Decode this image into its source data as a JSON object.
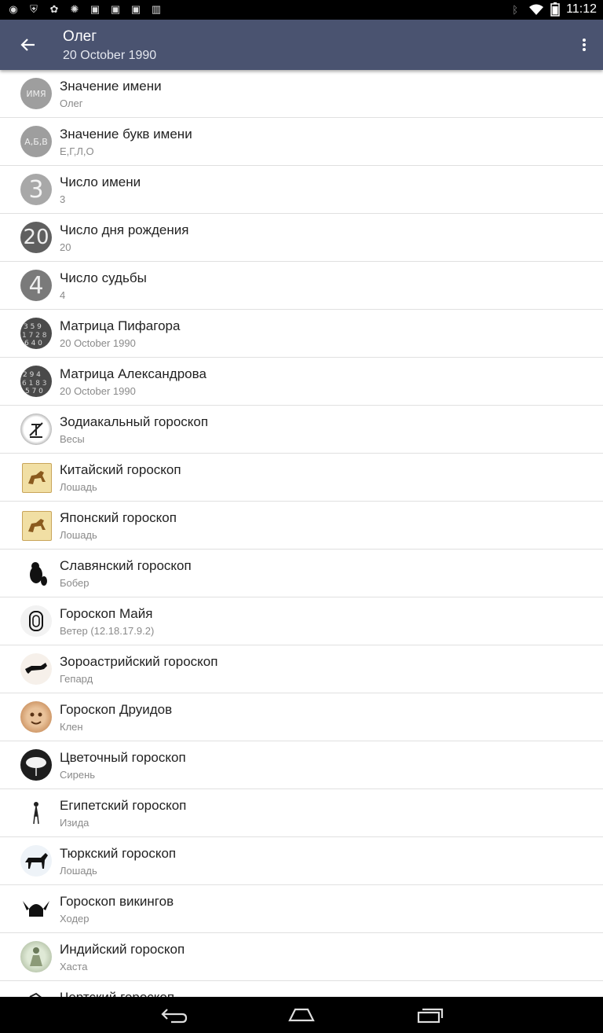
{
  "status_bar": {
    "time": "11:12"
  },
  "appbar": {
    "title": "Олег",
    "subtitle": "20 October 1990"
  },
  "items": [
    {
      "title": "Значение имени",
      "subtitle": "Олег",
      "icon": "ИМЯ"
    },
    {
      "title": "Значение букв имени",
      "subtitle": "Е,Г,Л,О",
      "icon": "А,Б,В"
    },
    {
      "title": "Число имени",
      "subtitle": "3",
      "icon": "3"
    },
    {
      "title": "Число дня рождения",
      "subtitle": "20",
      "icon": "20"
    },
    {
      "title": "Число судьбы",
      "subtitle": "4",
      "icon": "4"
    },
    {
      "title": "Матрица Пифагора",
      "subtitle": "20 October 1990",
      "icon": "pythagoras-matrix-icon"
    },
    {
      "title": "Матрица Александрова",
      "subtitle": "20 October 1990",
      "icon": "alexandrov-matrix-icon"
    },
    {
      "title": "Зодиакальный гороскоп",
      "subtitle": "Весы",
      "icon": "libra-icon"
    },
    {
      "title": "Китайский гороскоп",
      "subtitle": "Лошадь",
      "icon": "horse-scroll-icon"
    },
    {
      "title": "Японский гороскоп",
      "subtitle": "Лошадь",
      "icon": "horse-scroll-icon"
    },
    {
      "title": "Славянский гороскоп",
      "subtitle": "Бобер",
      "icon": "beaver-icon"
    },
    {
      "title": "Гороскоп Майя",
      "subtitle": "Ветер (12.18.17.9.2)",
      "icon": "maya-glyph-icon"
    },
    {
      "title": "Зороастрийский гороскоп",
      "subtitle": "Гепард",
      "icon": "cheetah-icon"
    },
    {
      "title": "Гороскоп Друидов",
      "subtitle": "Клен",
      "icon": "druid-face-icon"
    },
    {
      "title": "Цветочный гороскоп",
      "subtitle": "Сирень",
      "icon": "lilac-flower-icon"
    },
    {
      "title": "Египетский гороскоп",
      "subtitle": "Изида",
      "icon": "isis-icon"
    },
    {
      "title": "Тюркский гороскоп",
      "subtitle": "Лошадь",
      "icon": "horse-icon"
    },
    {
      "title": "Гороскоп викингов",
      "subtitle": "Ходер",
      "icon": "viking-helmet-icon"
    },
    {
      "title": "Индийский гороскоп",
      "subtitle": "Хаста",
      "icon": "hindu-deity-icon"
    },
    {
      "title": "Чертский гороскоп",
      "subtitle": "",
      "icon": "partial-icon"
    }
  ],
  "colors": {
    "appbar": "#4a5370",
    "divider": "#e0e0e0",
    "subtitle_gray": "#8a8a8a"
  }
}
